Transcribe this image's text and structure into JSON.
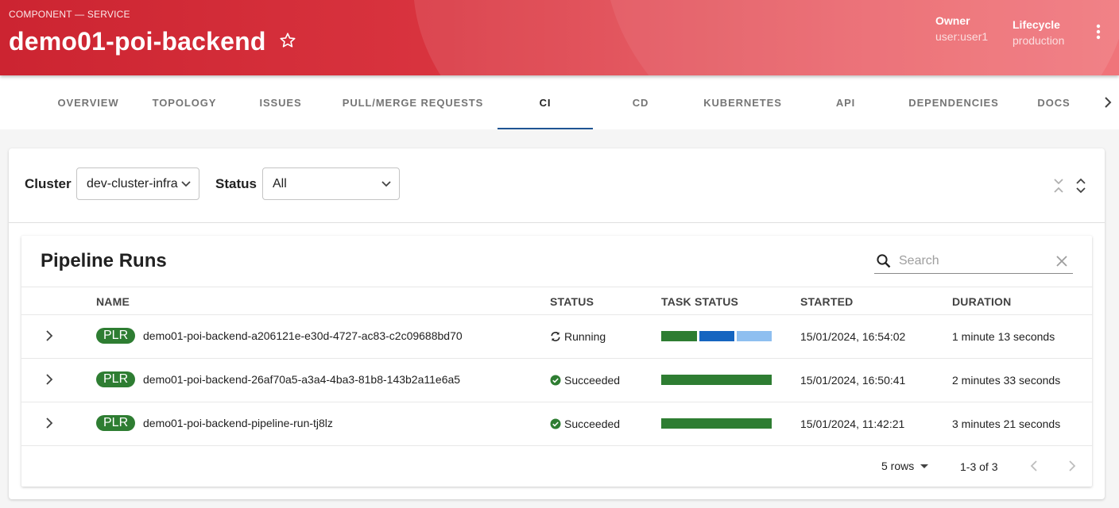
{
  "header": {
    "kind": "COMPONENT — SERVICE",
    "title": "demo01-poi-backend",
    "owner_label": "Owner",
    "owner_value": "user:user1",
    "lifecycle_label": "Lifecycle",
    "lifecycle_value": "production"
  },
  "tabs": [
    {
      "label": "OVERVIEW"
    },
    {
      "label": "TOPOLOGY"
    },
    {
      "label": "ISSUES"
    },
    {
      "label": "PULL/MERGE REQUESTS"
    },
    {
      "label": "CI",
      "active": true
    },
    {
      "label": "CD"
    },
    {
      "label": "KUBERNETES"
    },
    {
      "label": "API"
    },
    {
      "label": "DEPENDENCIES"
    },
    {
      "label": "DOCS"
    }
  ],
  "filters": {
    "cluster_label": "Cluster",
    "cluster_value": "dev-cluster-infra",
    "status_label": "Status",
    "status_value": "All"
  },
  "table": {
    "title": "Pipeline Runs",
    "search_placeholder": "Search",
    "columns": [
      "NAME",
      "STATUS",
      "TASK STATUS",
      "STARTED",
      "DURATION"
    ],
    "rows": [
      {
        "badge": "PLR",
        "name": "demo01-poi-backend-a206121e-e30d-4727-ac83-c2c09688bd70",
        "status": "Running",
        "status_icon": "sync-icon",
        "task_status": [
          {
            "state": "succeeded",
            "color": "#2e7d32"
          },
          {
            "state": "running",
            "color": "#1565c0"
          },
          {
            "state": "pending",
            "color": "#8ebff0"
          }
        ],
        "started": "15/01/2024, 16:54:02",
        "duration": "1 minute 13 seconds"
      },
      {
        "badge": "PLR",
        "name": "demo01-poi-backend-26af70a5-a3a4-4ba3-81b8-143b2a11e6a5",
        "status": "Succeeded",
        "status_icon": "check-circle-icon",
        "task_status": [
          {
            "state": "succeeded",
            "color": "#2e7d32"
          }
        ],
        "started": "15/01/2024, 16:50:41",
        "duration": "2 minutes 33 seconds"
      },
      {
        "badge": "PLR",
        "name": "demo01-poi-backend-pipeline-run-tj8lz",
        "status": "Succeeded",
        "status_icon": "check-circle-icon",
        "task_status": [
          {
            "state": "succeeded",
            "color": "#2e7d32"
          }
        ],
        "started": "15/01/2024, 11:42:21",
        "duration": "3 minutes 21 seconds"
      }
    ],
    "pagination": {
      "rows_per_page": "5 rows",
      "range": "1-3 of 3"
    }
  },
  "colors": {
    "header_start": "#cc2431",
    "header_end": "#ef6a70",
    "tab_indicator": "#1f5493",
    "badge": "#2e7d32"
  }
}
